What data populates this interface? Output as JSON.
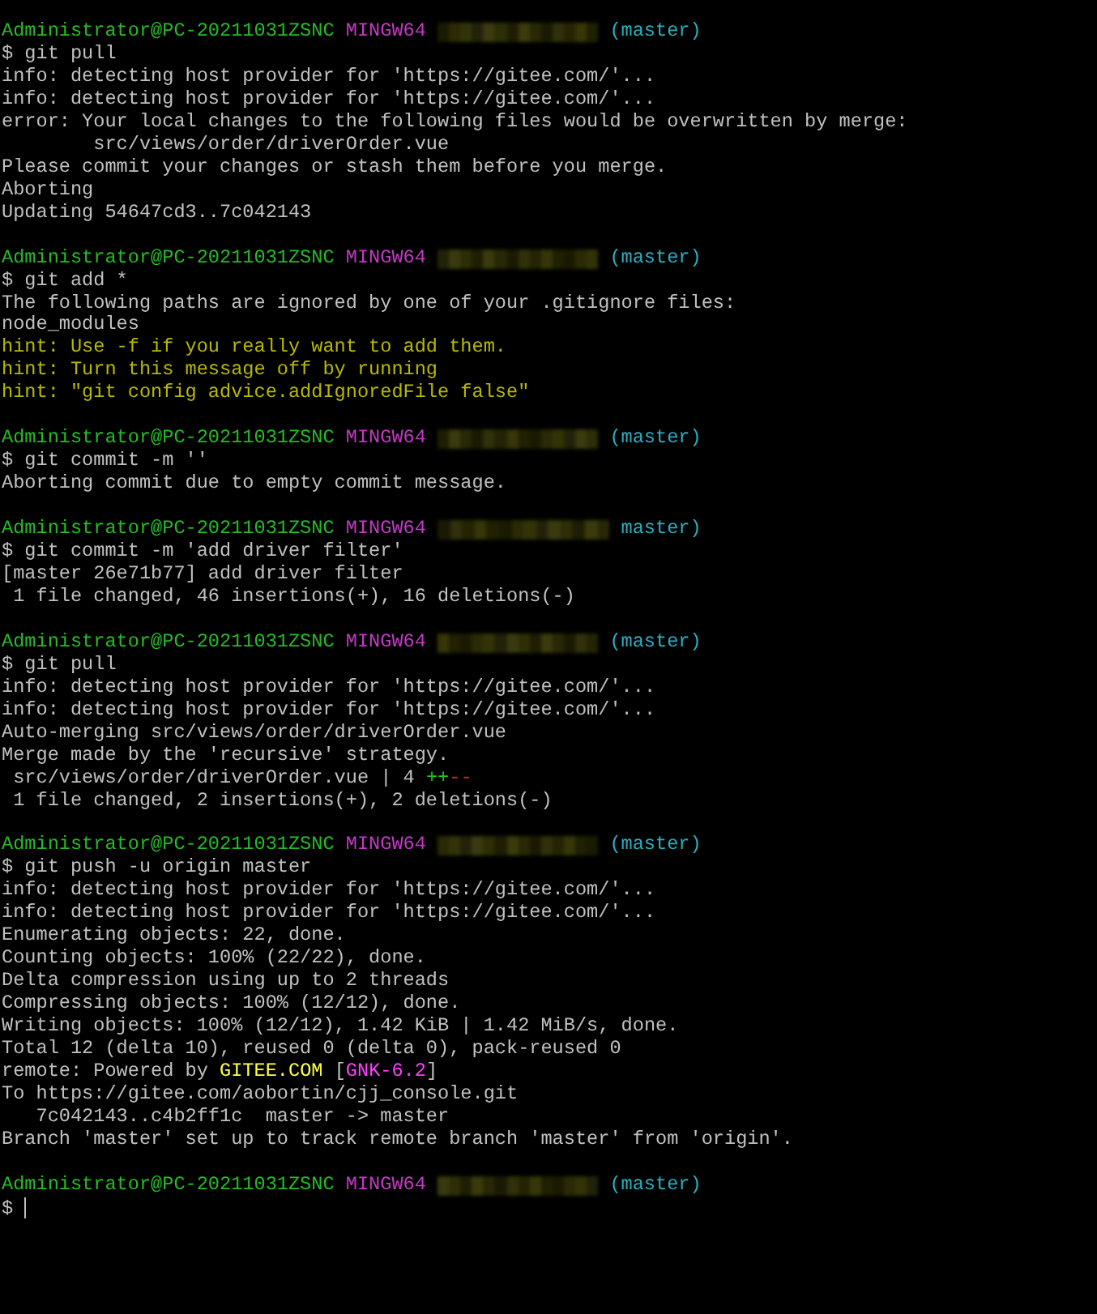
{
  "terminal": {
    "blocks": [
      {
        "prompt": {
          "user_host": "Administrator@PC-20211031ZSNC",
          "system": "MINGW64",
          "branch": "(master)"
        },
        "command": "$ git pull",
        "output": [
          {
            "segments": [
              {
                "text": "info: detecting host provider for 'https://gitee.com/'...",
                "kind": "plain"
              }
            ]
          },
          {
            "segments": [
              {
                "text": "info: detecting host provider for 'https://gitee.com/'...",
                "kind": "plain"
              }
            ]
          },
          {
            "segments": [
              {
                "text": "error: Your local changes to the following files would be overwritten by merge:",
                "kind": "plain"
              }
            ]
          },
          {
            "segments": [
              {
                "text": "        src/views/order/driverOrder.vue",
                "kind": "plain"
              }
            ]
          },
          {
            "segments": [
              {
                "text": "Please commit your changes or stash them before you merge.",
                "kind": "plain"
              }
            ]
          },
          {
            "segments": [
              {
                "text": "Aborting",
                "kind": "plain"
              }
            ]
          },
          {
            "segments": [
              {
                "text": "Updating 54647cd3..7c042143",
                "kind": "plain"
              }
            ]
          }
        ]
      },
      {
        "prompt": {
          "user_host": "Administrator@PC-20211031ZSNC",
          "system": "MINGW64",
          "branch": "(master)"
        },
        "command": "$ git add *",
        "output": [
          {
            "segments": [
              {
                "text": "The following paths are ignored by one of your .gitignore files:",
                "kind": "plain"
              }
            ]
          },
          {
            "segments": [
              {
                "text": "node_modules",
                "kind": "plain"
              }
            ]
          },
          {
            "segments": [
              {
                "text": "hint: Use -f if you really want to add them.",
                "kind": "hint"
              }
            ]
          },
          {
            "segments": [
              {
                "text": "hint: Turn this message off by running",
                "kind": "hint"
              }
            ]
          },
          {
            "segments": [
              {
                "text": "hint: \"git config advice.addIgnoredFile false\"",
                "kind": "hint"
              }
            ]
          }
        ]
      },
      {
        "prompt": {
          "user_host": "Administrator@PC-20211031ZSNC",
          "system": "MINGW64",
          "branch": "(master)"
        },
        "command": "$ git commit -m ''",
        "output": [
          {
            "segments": [
              {
                "text": "Aborting commit due to empty commit message.",
                "kind": "plain"
              }
            ]
          }
        ]
      },
      {
        "prompt": {
          "user_host": "Administrator@PC-20211031ZSNC",
          "system": "MINGW64",
          "branch": "master)"
        },
        "command": "$ git commit -m 'add driver filter'",
        "output": [
          {
            "segments": [
              {
                "text": "[master 26e71b77] add driver filter",
                "kind": "plain"
              }
            ]
          },
          {
            "segments": [
              {
                "text": " 1 file changed, 46 insertions(+), 16 deletions(-)",
                "kind": "plain"
              }
            ]
          }
        ]
      },
      {
        "prompt": {
          "user_host": "Administrator@PC-20211031ZSNC",
          "system": "MINGW64",
          "branch": "(master)"
        },
        "command": "$ git pull",
        "output": [
          {
            "segments": [
              {
                "text": "info: detecting host provider for 'https://gitee.com/'...",
                "kind": "plain"
              }
            ]
          },
          {
            "segments": [
              {
                "text": "info: detecting host provider for 'https://gitee.com/'...",
                "kind": "plain"
              }
            ]
          },
          {
            "segments": [
              {
                "text": "Auto-merging src/views/order/driverOrder.vue",
                "kind": "plain"
              }
            ]
          },
          {
            "segments": [
              {
                "text": "Merge made by the 'recursive' strategy.",
                "kind": "plain"
              }
            ]
          },
          {
            "segments": [
              {
                "text": " src/views/order/driverOrder.vue | 4",
                "kind": "plain"
              },
              {
                "text": "++",
                "kind": "added"
              },
              {
                "text": "--",
                "kind": "removed"
              }
            ]
          },
          {
            "segments": [
              {
                "text": " 1 file changed, 2 insertions(+), 2 deletions(-)",
                "kind": "plain"
              }
            ]
          }
        ]
      },
      {
        "prompt": {
          "user_host": "Administrator@PC-20211031ZSNC",
          "system": "MINGW64",
          "branch": "(master)"
        },
        "command": "$ git push -u origin master",
        "output": [
          {
            "segments": [
              {
                "text": "info: detecting host provider for 'https://gitee.com/'...",
                "kind": "plain"
              }
            ]
          },
          {
            "segments": [
              {
                "text": "info: detecting host provider for 'https://gitee.com/'...",
                "kind": "plain"
              }
            ]
          },
          {
            "segments": [
              {
                "text": "Enumerating objects: 22, done.",
                "kind": "plain"
              }
            ]
          },
          {
            "segments": [
              {
                "text": "Counting objects: 100% (22/22), done.",
                "kind": "plain"
              }
            ]
          },
          {
            "segments": [
              {
                "text": "Delta compression using up to 2 threads",
                "kind": "plain"
              }
            ]
          },
          {
            "segments": [
              {
                "text": "Compressing objects: 100% (12/12), done.",
                "kind": "plain"
              }
            ]
          },
          {
            "segments": [
              {
                "text": "Writing objects: 100% (12/12), 1.42 KiB | 1.42 MiB/s, done.",
                "kind": "plain"
              }
            ]
          },
          {
            "segments": [
              {
                "text": "Total 12 (delta 10), reused 0 (delta 0), pack-reused 0",
                "kind": "plain"
              }
            ]
          },
          {
            "segments": [
              {
                "text": "remote: Powered by",
                "kind": "plain"
              },
              {
                "text": "GITEE.COM",
                "kind": "brand"
              },
              {
                "text": "[",
                "kind": "plain"
              },
              {
                "text": "GNK-6.2",
                "kind": "version"
              },
              {
                "text": "]",
                "kind": "plain"
              }
            ]
          },
          {
            "segments": [
              {
                "text": "To https://gitee.com/aobortin/cjj_console.git",
                "kind": "plain"
              }
            ]
          },
          {
            "segments": [
              {
                "text": "   7c042143..c4b2ff1c  master -> master",
                "kind": "plain"
              }
            ]
          },
          {
            "segments": [
              {
                "text": "Branch 'master' set up to track remote branch 'master' from 'origin'.",
                "kind": "plain"
              }
            ]
          }
        ]
      },
      {
        "prompt": {
          "user_host": "Administrator@PC-20211031ZSNC",
          "system": "MINGW64",
          "branch": "(master)"
        },
        "command": "$",
        "cursor": true
      }
    ]
  }
}
